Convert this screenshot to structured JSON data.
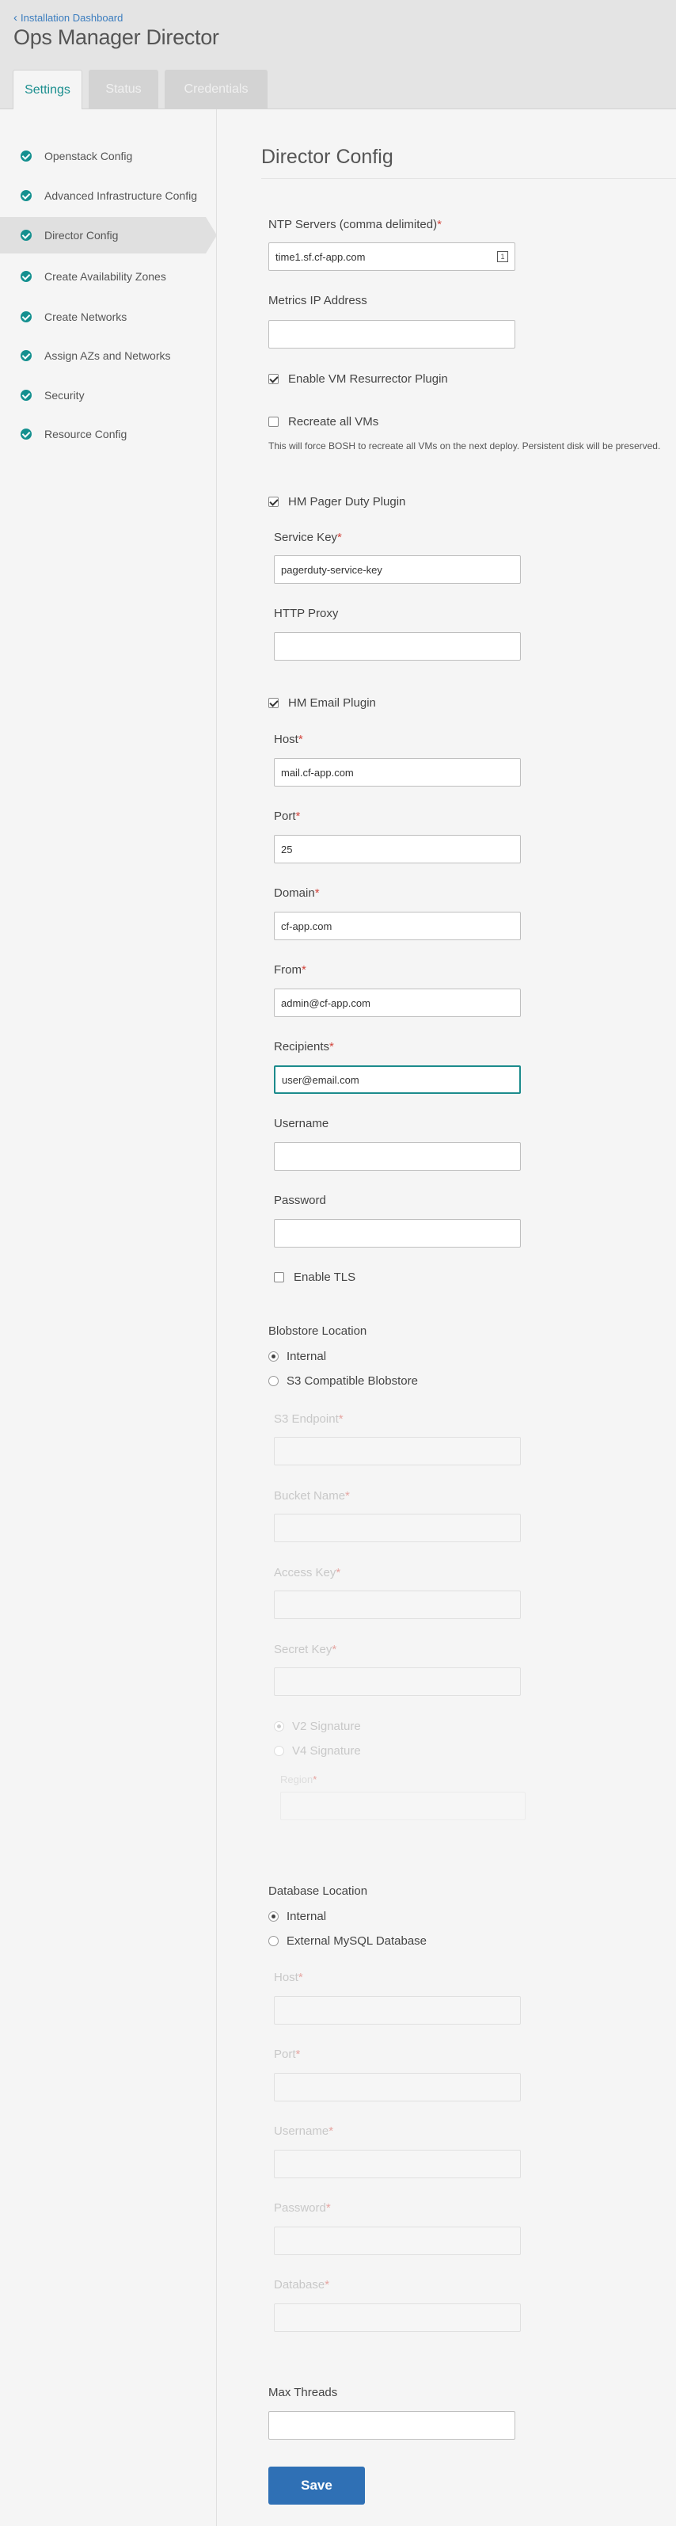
{
  "header": {
    "back_label": "Installation Dashboard",
    "title": "Ops Manager Director",
    "tabs": [
      {
        "label": "Settings",
        "active": true
      },
      {
        "label": "Status",
        "active": false
      },
      {
        "label": "Credentials",
        "active": false
      }
    ]
  },
  "sidebar": {
    "items": [
      {
        "label": "Openstack Config"
      },
      {
        "label": "Advanced Infrastructure Config"
      },
      {
        "label": "Director Config",
        "active": true
      },
      {
        "label": "Create Availability Zones"
      },
      {
        "label": "Create Networks"
      },
      {
        "label": "Assign AZs and Networks"
      },
      {
        "label": "Security"
      },
      {
        "label": "Resource Config"
      }
    ]
  },
  "form": {
    "title": "Director Config",
    "ntp_label": "NTP Servers (comma delimited)",
    "ntp_value": "time1.sf.cf-app.com",
    "metrics_label": "Metrics IP Address",
    "metrics_value": "",
    "vm_resurrector_label": "Enable VM Resurrector Plugin",
    "vm_resurrector_checked": true,
    "recreate_label": "Recreate all VMs",
    "recreate_checked": false,
    "recreate_note": "This will force BOSH to recreate all VMs on the next deploy. Persistent disk will be preserved.",
    "pager_label": "HM Pager Duty Plugin",
    "pager_checked": true,
    "service_key_label": "Service Key",
    "service_key_value": "pagerduty-service-key",
    "http_proxy_label": "HTTP Proxy",
    "http_proxy_value": "",
    "email_label": "HM Email Plugin",
    "email_checked": true,
    "host_label": "Host",
    "host_value": "mail.cf-app.com",
    "port_label": "Port",
    "port_value": "25",
    "domain_label": "Domain",
    "domain_value": "cf-app.com",
    "from_label": "From",
    "from_value": "admin@cf-app.com",
    "recipients_label": "Recipients",
    "recipients_value": "user@email.com",
    "username_label": "Username",
    "password_label": "Password",
    "tls_label": "Enable TLS",
    "tls_checked": false,
    "blobstore_label": "Blobstore Location",
    "blobstore_internal": "Internal",
    "blobstore_s3": "S3 Compatible Blobstore",
    "s3_endpoint_label": "S3 Endpoint",
    "bucket_label": "Bucket Name",
    "access_key_label": "Access Key",
    "secret_key_label": "Secret Key",
    "v2_label": "V2 Signature",
    "v4_label": "V4 Signature",
    "region_label": "Region",
    "database_label": "Database Location",
    "db_internal": "Internal",
    "db_external": "External MySQL Database",
    "db_host_label": "Host",
    "db_port_label": "Port",
    "db_username_label": "Username",
    "db_password_label": "Password",
    "db_database_label": "Database",
    "max_threads_label": "Max Threads",
    "max_threads_value": "",
    "save_label": "Save",
    "required_mark": "*"
  },
  "colors": {
    "accent": "#14908f",
    "save": "#2f70b5",
    "link": "#3b7dbf",
    "required": "#d2443c"
  }
}
